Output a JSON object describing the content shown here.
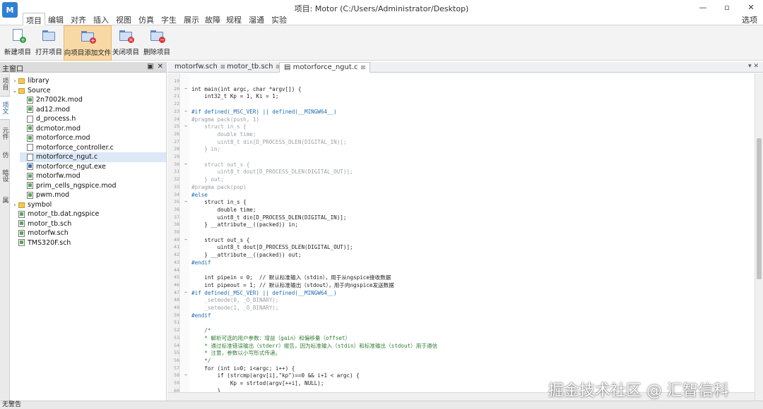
{
  "window": {
    "title": "项目: Motor (C:/Users/Administrator/Desktop)",
    "logo_text": "M"
  },
  "menu": {
    "tabs": [
      "项目",
      "编辑",
      "对齐",
      "插入",
      "视图",
      "仿真",
      "字生",
      "展示",
      "故障",
      "规程",
      "溜通",
      "实验"
    ],
    "active": "项目",
    "right_label": "选项"
  },
  "ribbon": {
    "buttons": [
      {
        "label": "新建项目",
        "icon": "new-project-icon"
      },
      {
        "label": "打开项目",
        "icon": "open-project-icon"
      },
      {
        "label": "向项目添加文件",
        "icon": "add-file-icon",
        "highlighted": true
      },
      {
        "label": "关闭项目",
        "icon": "close-project-icon"
      },
      {
        "label": "删除项目",
        "icon": "delete-project-icon"
      }
    ]
  },
  "left_panel": {
    "title": "主窗口",
    "vertical_tabs": [
      "项目",
      "项文",
      "元件",
      "仿",
      "暗设",
      "属"
    ],
    "tree": [
      {
        "label": "library",
        "type": "folder",
        "depth": 0,
        "expanded": false
      },
      {
        "label": "Source",
        "type": "folder",
        "depth": 0,
        "expanded": true
      },
      {
        "label": "2n7002k.mod",
        "type": "file-green",
        "depth": 1
      },
      {
        "label": "ad12.mod",
        "type": "file-green",
        "depth": 1
      },
      {
        "label": "d_process.h",
        "type": "file",
        "depth": 1
      },
      {
        "label": "dcmotor.mod",
        "type": "file-green",
        "depth": 1
      },
      {
        "label": "motorforce.mod",
        "type": "file-green",
        "depth": 1
      },
      {
        "label": "motorforce_controller.c",
        "type": "file",
        "depth": 1
      },
      {
        "label": "motorforce_ngut.c",
        "type": "file",
        "depth": 1,
        "selected": true
      },
      {
        "label": "motorforce_ngut.exe",
        "type": "file-blue",
        "depth": 1
      },
      {
        "label": "motorfw.mod",
        "type": "file-green",
        "depth": 1
      },
      {
        "label": "prim_cells_ngspice.mod",
        "type": "file-green",
        "depth": 1
      },
      {
        "label": "pwm.mod",
        "type": "file-green",
        "depth": 1
      },
      {
        "label": "symbol",
        "type": "folder",
        "depth": 0,
        "expanded": false
      },
      {
        "label": "motor_tb.dat.ngspice",
        "type": "file-green",
        "depth": 0
      },
      {
        "label": "motor_tb.sch",
        "type": "file-green",
        "depth": 0
      },
      {
        "label": "motorfw.sch",
        "type": "file-green",
        "depth": 0
      },
      {
        "label": "TMS320F.sch",
        "type": "file-green",
        "depth": 0
      }
    ]
  },
  "editor": {
    "tabs": [
      {
        "label": "motorfw.sch",
        "active": false
      },
      {
        "label": "motor_tb.sch",
        "active": false
      },
      {
        "label": "motorforce_ngut.c",
        "active": true
      }
    ],
    "tab_menu": "▾ ✕",
    "lines": [
      {
        "n": "19",
        "text": "",
        "style": "plain"
      },
      {
        "n": "20",
        "fold": "−",
        "text": "int main(int argc, char *argv[]) {",
        "style": "plain"
      },
      {
        "n": "21",
        "text": "    int32_t Kp = 1, Ki = 1;",
        "style": "plain"
      },
      {
        "n": "22",
        "text": "",
        "style": "plain"
      },
      {
        "n": "23",
        "fold": "−",
        "text": "#if defined(_MSC_VER) || defined(__MINGW64__)",
        "style": "pp"
      },
      {
        "n": "24",
        "text": "#pragma pack(push, 1)",
        "style": "gray"
      },
      {
        "n": "25",
        "fold": "−",
        "text": "    struct in_s {",
        "style": "gray"
      },
      {
        "n": "26",
        "text": "        double time;",
        "style": "gray"
      },
      {
        "n": "27",
        "text": "        uint8_t din[D_PROCESS_DLEN(DIGITAL_IN)];",
        "style": "gray"
      },
      {
        "n": "28",
        "text": "    } in;",
        "style": "gray"
      },
      {
        "n": "29",
        "text": "",
        "style": "plain"
      },
      {
        "n": "30",
        "fold": "−",
        "text": "    struct out_s {",
        "style": "gray"
      },
      {
        "n": "31",
        "text": "        uint8_t dout[D_PROCESS_DLEN(DIGITAL_OUT)];",
        "style": "gray"
      },
      {
        "n": "32",
        "text": "    } out;",
        "style": "gray"
      },
      {
        "n": "33",
        "text": "#pragma pack(pop)",
        "style": "gray"
      },
      {
        "n": "34",
        "text": "#else",
        "style": "pp"
      },
      {
        "n": "35",
        "fold": "−",
        "text": "    struct in_s {",
        "style": "plain"
      },
      {
        "n": "36",
        "text": "        double time;",
        "style": "plain"
      },
      {
        "n": "37",
        "text": "        uint8_t din[D_PROCESS_DLEN(DIGITAL_IN)];",
        "style": "plain"
      },
      {
        "n": "38",
        "text": "    } __attribute__((packed)) in;",
        "style": "plain"
      },
      {
        "n": "39",
        "text": "",
        "style": "plain"
      },
      {
        "n": "40",
        "fold": "−",
        "text": "    struct out_s {",
        "style": "plain"
      },
      {
        "n": "41",
        "text": "        uint8_t dout[D_PROCESS_DLEN(DIGITAL_OUT)];",
        "style": "plain"
      },
      {
        "n": "42",
        "text": "    } __attribute__((packed)) out;",
        "style": "plain"
      },
      {
        "n": "43",
        "text": "#endif",
        "style": "pp"
      },
      {
        "n": "44",
        "text": "",
        "style": "plain"
      },
      {
        "n": "45",
        "text": "    int pipein = 0;  // 默认标准输入（stdin），用于从ngspice接收数据",
        "style": "plain"
      },
      {
        "n": "46",
        "text": "    int pipeout = 1; // 默认标准输出（stdout），用于向ngspice发送数据",
        "style": "plain"
      },
      {
        "n": "47",
        "fold": "−",
        "text": "#if defined(_MSC_VER) || defined(__MINGW64__)",
        "style": "pp"
      },
      {
        "n": "48",
        "text": "    _setmode(0, _O_BINARY);",
        "style": "gray"
      },
      {
        "n": "49",
        "text": "    _setmode(1, _O_BINARY);",
        "style": "gray"
      },
      {
        "n": "50",
        "text": "#endif",
        "style": "pp"
      },
      {
        "n": "51",
        "text": "",
        "style": "plain"
      },
      {
        "n": "52",
        "text": "    /*",
        "style": "cm"
      },
      {
        "n": "53",
        "text": "    * 解析可选的用户参数：增益（gain）和偏移量（offset）",
        "style": "cm"
      },
      {
        "n": "54",
        "text": "    * 通过标准错误输出（stderr）报告，因为标准输入（stdin）和标准输出（stdout）用于通信",
        "style": "cm"
      },
      {
        "n": "55",
        "text": "    * 注意，参数以小写形式传递。",
        "style": "cm"
      },
      {
        "n": "56",
        "text": "    */",
        "style": "cm"
      },
      {
        "n": "57",
        "text": "    for (int i=0; i<argc; i++) {",
        "style": "plain"
      },
      {
        "n": "58",
        "fold": "−",
        "text": "        if (strcmp(argv[i],\"kp\")==0 && i+1 < argc) {",
        "style": "plain"
      },
      {
        "n": "59",
        "text": "            Kp = strtod(argv[++i], NULL);",
        "style": "plain"
      },
      {
        "n": "60",
        "text": "        }",
        "style": "plain"
      }
    ]
  },
  "status": {
    "text": "无警告"
  },
  "watermark": "掘金技术社区 @ 汇智信科"
}
